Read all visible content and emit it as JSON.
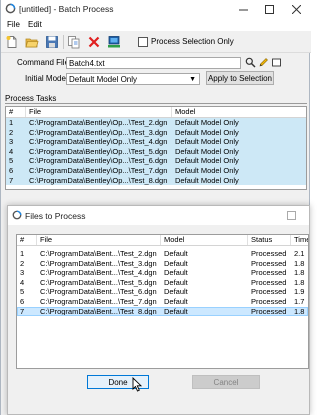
{
  "window": {
    "title": "[untitled] - Batch Process"
  },
  "menu": {
    "file": "File",
    "edit": "Edit"
  },
  "toolbar": {
    "process_selection_label": "Process Selection Only"
  },
  "command_file": {
    "label": "Command File",
    "value": "Batch4.txt"
  },
  "initial_model": {
    "label": "Initial Model",
    "value": "Default Model Only"
  },
  "apply_button": "Apply to Selection",
  "process_tasks": {
    "label": "Process Tasks",
    "columns": [
      "#",
      "File",
      "Model"
    ],
    "rows": [
      {
        "num": "1",
        "file": "C:\\ProgramData\\Bentley\\Op...\\Test_2.dgn",
        "model": "Default Model Only"
      },
      {
        "num": "2",
        "file": "C:\\ProgramData\\Bentley\\Op...\\Test_3.dgn",
        "model": "Default Model Only"
      },
      {
        "num": "3",
        "file": "C:\\ProgramData\\Bentley\\Op...\\Test_4.dgn",
        "model": "Default Model Only"
      },
      {
        "num": "4",
        "file": "C:\\ProgramData\\Bentley\\Op...\\Test_5.dgn",
        "model": "Default Model Only"
      },
      {
        "num": "5",
        "file": "C:\\ProgramData\\Bentley\\Op...\\Test_6.dgn",
        "model": "Default Model Only"
      },
      {
        "num": "6",
        "file": "C:\\ProgramData\\Bentley\\Op...\\Test_7.dgn",
        "model": "Default Model Only"
      },
      {
        "num": "7",
        "file": "C:\\ProgramData\\Bentley\\Op...\\Test_8.dgn",
        "model": "Default Model Only"
      }
    ]
  },
  "dialog": {
    "title": "Files to Process",
    "columns": [
      "#",
      "File",
      "Model",
      "Status",
      "Time"
    ],
    "rows": [
      {
        "num": "1",
        "file": "C:\\ProgramData\\Bent...\\Test_2.dgn",
        "model": "Default",
        "status": "Processed",
        "time": "2.1"
      },
      {
        "num": "2",
        "file": "C:\\ProgramData\\Bent...\\Test_3.dgn",
        "model": "Default",
        "status": "Processed",
        "time": "1.8"
      },
      {
        "num": "3",
        "file": "C:\\ProgramData\\Bent...\\Test_4.dgn",
        "model": "Default",
        "status": "Processed",
        "time": "1.8"
      },
      {
        "num": "4",
        "file": "C:\\ProgramData\\Bent...\\Test_5.dgn",
        "model": "Default",
        "status": "Processed",
        "time": "1.8"
      },
      {
        "num": "5",
        "file": "C:\\ProgramData\\Bent...\\Test_6.dgn",
        "model": "Default",
        "status": "Processed",
        "time": "1.9"
      },
      {
        "num": "6",
        "file": "C:\\ProgramData\\Bent...\\Test_7.dgn",
        "model": "Default",
        "status": "Processed",
        "time": "1.7"
      },
      {
        "num": "7",
        "file": "C:\\ProgramData\\Bent...\\Test_8.dgn",
        "model": "Default",
        "status": "Processed",
        "time": "1.8"
      }
    ],
    "done_label": "Done",
    "cancel_label": "Cancel"
  },
  "colors": {
    "accent": "#0078d7",
    "row_highlight": "#cde8f6",
    "row_selected": "#cce8ff"
  }
}
